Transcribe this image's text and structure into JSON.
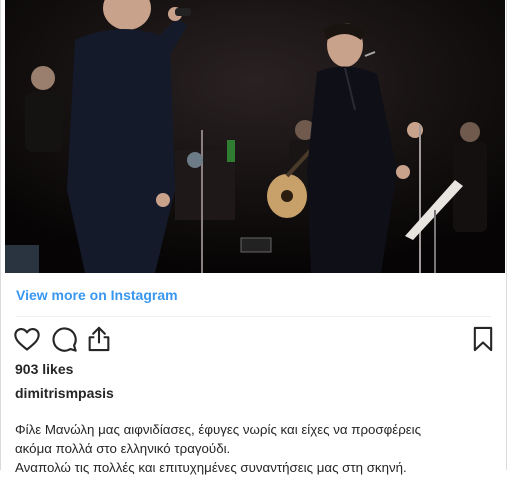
{
  "embed": {
    "view_more_label": "View more on Instagram",
    "actions": {
      "like_icon": "heart-icon",
      "comment_icon": "comment-icon",
      "share_icon": "share-icon",
      "save_icon": "bookmark-icon"
    },
    "likes": "903 likes",
    "username": "dimitrismpasis",
    "caption_lines": [
      "Φίλε Μανώλη μας αιφνιδίασες, έφυγες νωρίς και είχες να προσφέρεις",
      "ακόμα πολλά στο ελληνικό τραγούδι.",
      "Αναπολώ τις πολλές και επιτυχημένες συναντήσεις μας στη σκηνή."
    ]
  },
  "colors": {
    "link": "#3897f0",
    "text": "#262626",
    "photo_background": "#080606"
  }
}
